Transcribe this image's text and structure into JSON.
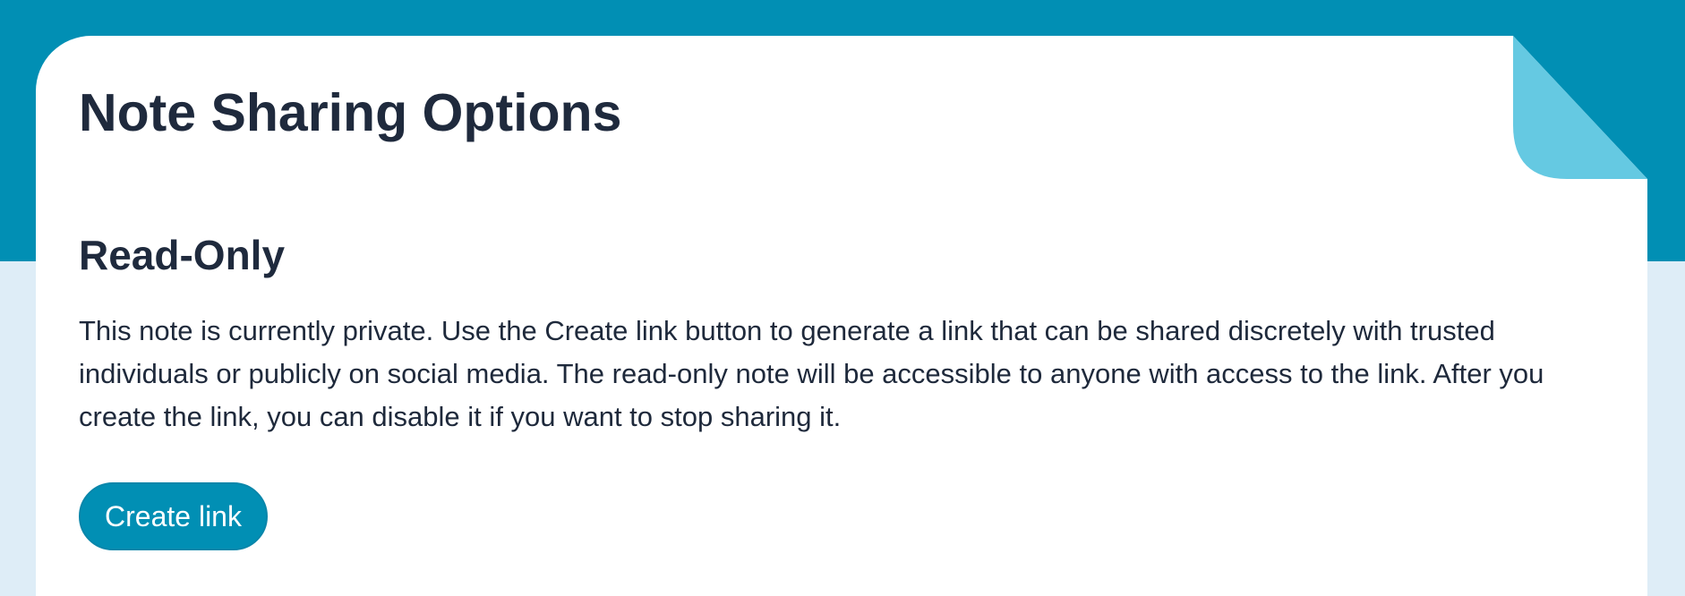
{
  "page": {
    "title": "Note Sharing Options"
  },
  "section": {
    "heading": "Read-Only",
    "description": "This note is currently private. Use the Create link button to generate a link that can be shared discretely with trusted individuals or publicly on social media. The read-only note will be accessible to anyone with access to the link. After you create the link, you can disable it if you want to stop sharing it.",
    "button_label": "Create link"
  },
  "colors": {
    "accent": "#018fb4",
    "dogear": "#65c9e2",
    "background": "#deedf7",
    "card": "#ffffff",
    "text": "#1e293b"
  },
  "icons": {
    "dogear": "page-fold-icon"
  }
}
